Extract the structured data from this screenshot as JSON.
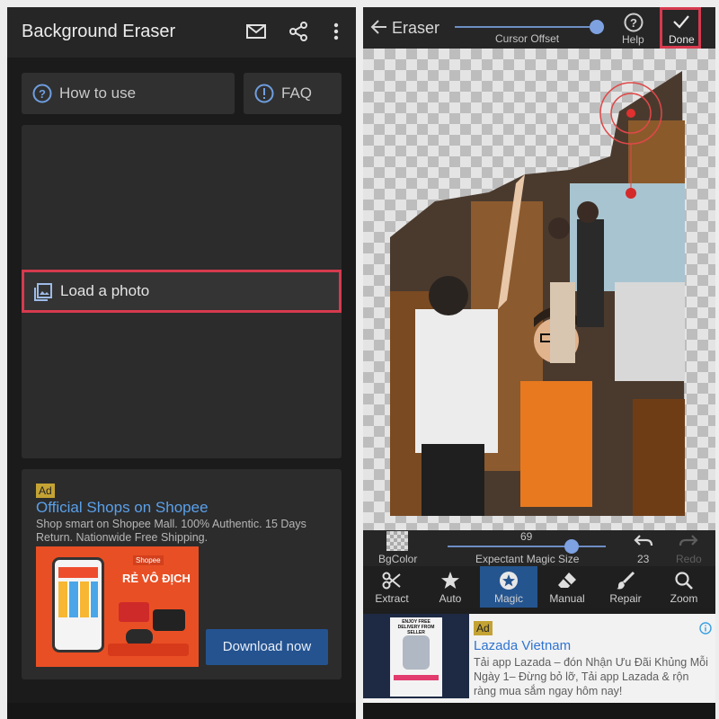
{
  "left": {
    "app_title": "Background Eraser",
    "header_icons": [
      "mail-icon",
      "share-icon",
      "more-vert-icon"
    ],
    "how_to_use_label": "How to use",
    "faq_label": "FAQ",
    "load_photo_label": "Load a photo",
    "ad": {
      "badge": "Ad",
      "title": "Official Shops on Shopee",
      "description": "Shop smart on Shopee Mall. 100% Authentic. 15 Days Return. Nationwide Free Shipping.",
      "image_brand": "Shopee",
      "image_headline": "RẺ VÔ ĐỊCH",
      "cta": "Download now"
    }
  },
  "right": {
    "title": "Eraser",
    "cursor_offset_label": "Cursor Offset",
    "help_label": "Help",
    "done_label": "Done",
    "bgcolor_label": "BgColor",
    "magic_size_value": "69",
    "magic_size_label": "Expectant Magic Size",
    "undo_count": "23",
    "redo_label": "Redo",
    "tools": [
      {
        "label": "Extract",
        "icon": "scissors-icon"
      },
      {
        "label": "Auto",
        "icon": "star-icon"
      },
      {
        "label": "Magic",
        "icon": "magic-star-icon",
        "active": true
      },
      {
        "label": "Manual",
        "icon": "eraser-icon"
      },
      {
        "label": "Repair",
        "icon": "brush-icon"
      },
      {
        "label": "Zoom",
        "icon": "zoom-icon"
      }
    ],
    "ad": {
      "badge": "Ad",
      "title": "Lazada Vietnam",
      "description": "Tải app Lazada – đón  Nhận Ưu Đãi Khủng Mỗi Ngày 1– Đừng bỏ lỡ, Tải app Lazada & rộn ràng mua sắm ngay hôm nay!",
      "thumb_banner": "ENJOY FREE DELIVERY FROM SELLER"
    }
  },
  "colors": {
    "highlight": "#d63a4e",
    "accent": "#7ea1e1",
    "active_tool": "#25558f",
    "ad_link": "#5aa0ea",
    "ad_badge": "#c4a334"
  }
}
